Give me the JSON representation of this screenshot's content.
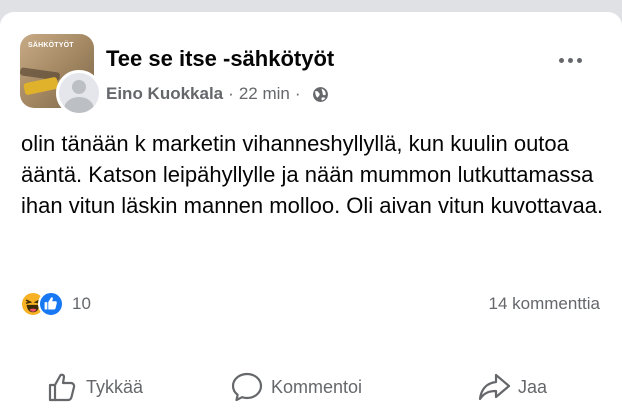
{
  "post": {
    "group_name": "Tee se itse -sähkötyöt",
    "group_avatar_text": "SÄHKÖTYÖT",
    "author": "Eino Kuokkala",
    "separator": "·",
    "time": "22 min",
    "audience_icon": "globe-icon",
    "more_icon": "more-horizontal-icon",
    "body": "olin tänään k marketin vihanneshyllyllä, kun kuulin outoa ääntä. Katson leipähyllylle ja nään mummon lutkuttamassa ihan vitun läskin mannen molloo. Oli aivan vitun kuvottavaa."
  },
  "reactions": {
    "icons": [
      "haha-icon",
      "like-icon"
    ],
    "count": "10",
    "comments": "14 kommenttia"
  },
  "actions": [
    {
      "label": "Tykkää",
      "icon": "thumbs-up-icon"
    },
    {
      "label": "Kommentoi",
      "icon": "comment-icon"
    },
    {
      "label": "Jaa",
      "icon": "share-icon"
    }
  ],
  "colors": {
    "text": "#050505",
    "secondary_text": "#65676b",
    "like_blue": "#1877f2",
    "haha_yellow": "#f7b125",
    "background": "#ffffff"
  }
}
